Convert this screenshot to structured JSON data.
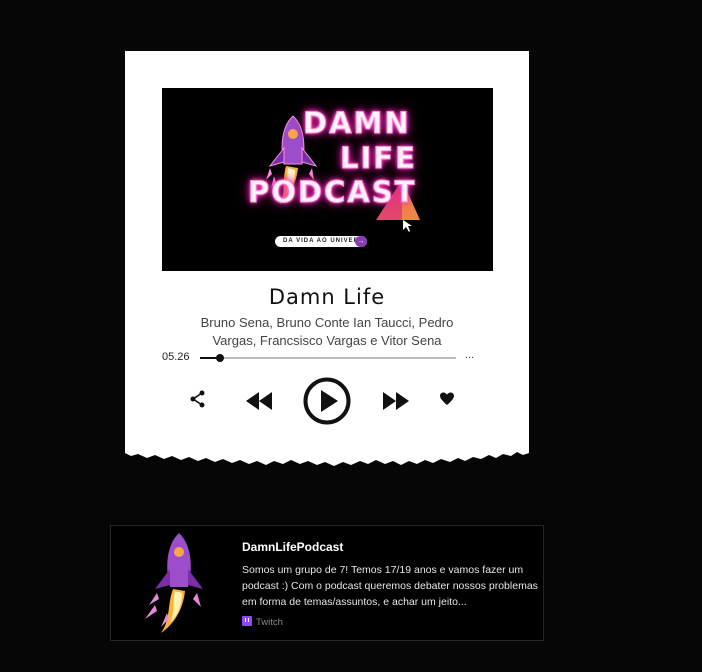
{
  "player": {
    "cover": {
      "line1": "DAMN",
      "line2": "LIFE",
      "line3": "PODCAST",
      "tagline": "DA VIDA AO UNIVERSO!",
      "neon_color": "#ff2fb8"
    },
    "title": "Damn Life",
    "artists": "Bruno Sena, Bruno Conte Ian Taucci, Pedro Vargas, Francsisco Vargas e Vitor Sena",
    "elapsed": "05.26",
    "more_label": "...",
    "progress_fraction": 0.08,
    "controls": [
      "share-icon",
      "rewind-icon",
      "play-icon",
      "fast-forward-icon",
      "heart-icon"
    ]
  },
  "widget": {
    "title": "DamnLifePodcast",
    "description": "Somos um grupo de 7! Temos 17/19 anos e vamos fazer um podcast :) Com o podcast queremos debater nossos problemas em forma de temas/assuntos, e achar um jeito...",
    "source": "Twitch",
    "source_color": "#9146ff"
  },
  "colors": {
    "background": "#060606",
    "card": "#ffffff",
    "rocket": "#9b4dca"
  }
}
